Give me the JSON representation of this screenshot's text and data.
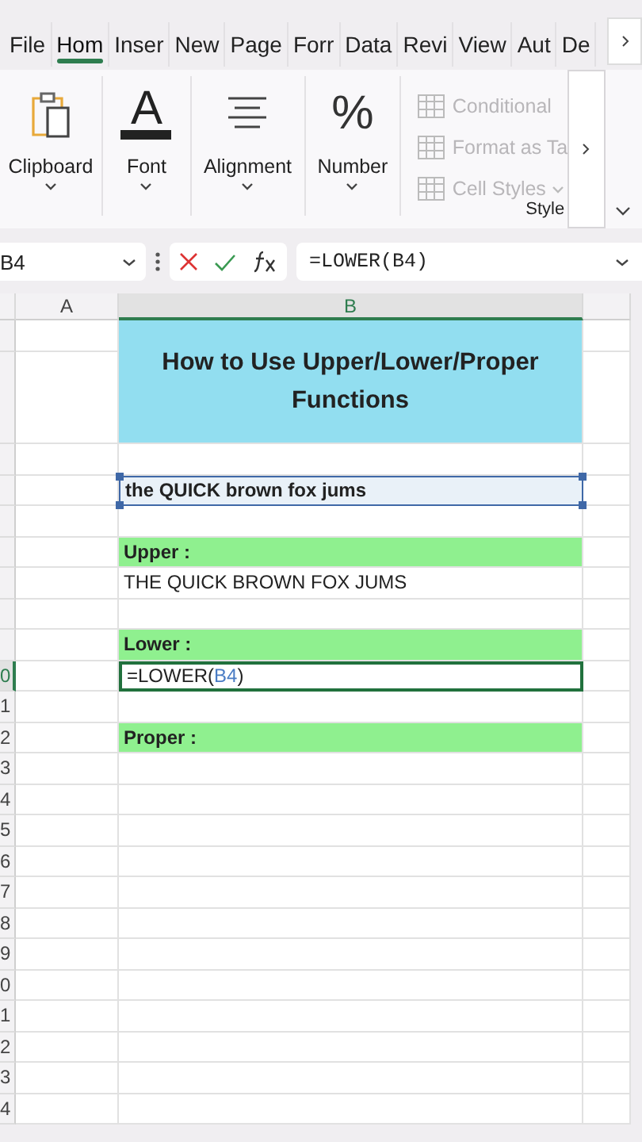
{
  "tabs": [
    {
      "label": "File",
      "selected": false
    },
    {
      "label": "Hom",
      "selected": true
    },
    {
      "label": "Inser",
      "selected": false
    },
    {
      "label": "New",
      "selected": false
    },
    {
      "label": "Page",
      "selected": false
    },
    {
      "label": "Forr",
      "selected": false
    },
    {
      "label": "Data",
      "selected": false
    },
    {
      "label": "Revi",
      "selected": false
    },
    {
      "label": "View",
      "selected": false
    },
    {
      "label": "Aut",
      "selected": false
    },
    {
      "label": "De",
      "selected": false
    }
  ],
  "ribbon": {
    "groups": [
      {
        "kind": "clipboard",
        "label": "Clipboard"
      },
      {
        "kind": "font",
        "label": "Font",
        "glyph": "A"
      },
      {
        "kind": "alignment",
        "label": "Alignment"
      },
      {
        "kind": "number",
        "label": "Number",
        "glyph": "%"
      },
      {
        "kind": "styles",
        "label": "Style",
        "items": [
          {
            "label": "Conditional",
            "disabled": true,
            "dropdown": false
          },
          {
            "label": "Format as Ta",
            "disabled": true,
            "dropdown": false
          },
          {
            "label": "Cell Styles",
            "disabled": true,
            "dropdown": true
          }
        ]
      }
    ]
  },
  "formula_bar": {
    "name_box": "B4",
    "formula": "=LOWER(B4)"
  },
  "sheet": {
    "columns": [
      {
        "label": "A",
        "selected": false
      },
      {
        "label": "B",
        "selected": true
      }
    ],
    "rows": [
      {
        "number": "",
        "selected": false,
        "cell": {
          "kind": "title",
          "text": "How to Use Upper/Lower/Proper Functions"
        }
      },
      {
        "number": "",
        "selected": false
      },
      {
        "number": "",
        "selected": false
      },
      {
        "number": "",
        "selected": false,
        "cell": {
          "kind": "input",
          "text": "the QUICK brown fox jums",
          "selected": true
        }
      },
      {
        "number": "",
        "selected": false
      },
      {
        "number": "",
        "selected": false,
        "cell": {
          "kind": "label",
          "text": "Upper :"
        }
      },
      {
        "number": "",
        "selected": false,
        "cell": {
          "kind": "output",
          "text": "THE QUICK BROWN FOX JUMS"
        }
      },
      {
        "number": "",
        "selected": false
      },
      {
        "number": "",
        "selected": false,
        "cell": {
          "kind": "label",
          "text": "Lower :"
        }
      },
      {
        "number": "0",
        "selected": true,
        "cell": {
          "kind": "editing",
          "text": "=LOWER(",
          "ref": "B4",
          "tail": ")"
        }
      },
      {
        "number": "1",
        "selected": false
      },
      {
        "number": "2",
        "selected": false,
        "cell": {
          "kind": "label",
          "text": "Proper :"
        }
      },
      {
        "number": "3",
        "selected": false
      },
      {
        "number": "4",
        "selected": false
      },
      {
        "number": "5",
        "selected": false
      },
      {
        "number": "6",
        "selected": false
      },
      {
        "number": "7",
        "selected": false
      },
      {
        "number": "8",
        "selected": false
      },
      {
        "number": "9",
        "selected": false
      },
      {
        "number": "0",
        "selected": false
      },
      {
        "number": "1",
        "selected": false
      },
      {
        "number": "2",
        "selected": false
      },
      {
        "number": "3",
        "selected": false
      },
      {
        "number": "4",
        "selected": false
      }
    ]
  }
}
